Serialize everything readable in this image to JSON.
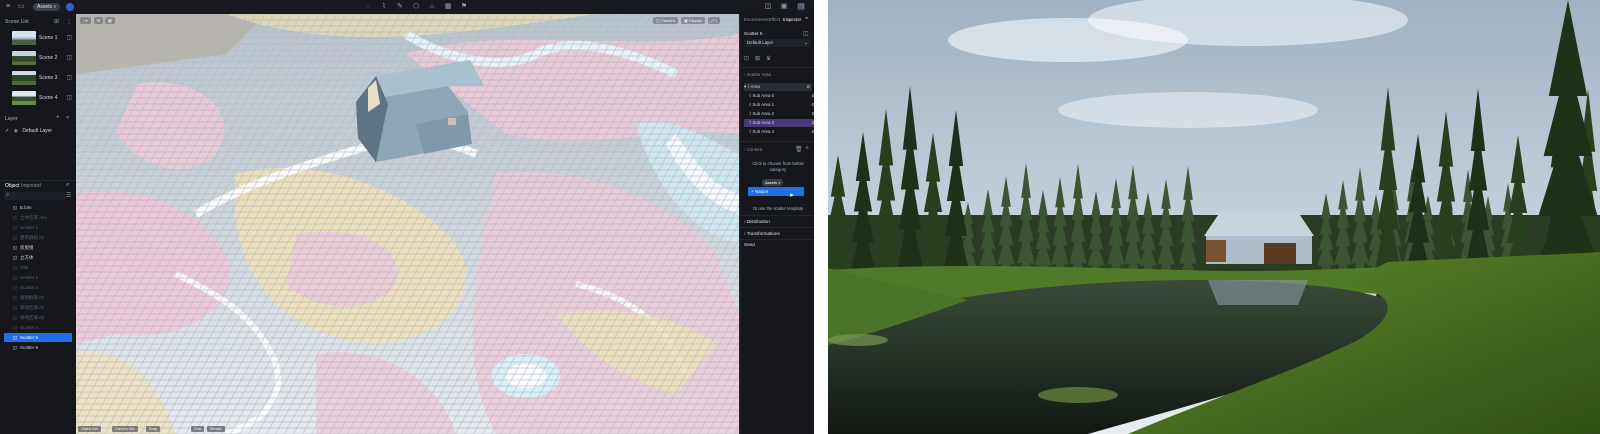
{
  "topbar": {
    "assets_label": "Assets"
  },
  "left": {
    "scene_list_title": "Scene List",
    "scenes": [
      "Scene 1",
      "Scene 2",
      "Scene 3",
      "Scene 4"
    ],
    "layer_title": "Layer",
    "default_layer": "Default Layer",
    "tabs": {
      "object": "Object",
      "imported": "Imported"
    },
    "objects": [
      {
        "label": "E.bim",
        "dim": false,
        "sel": false
      },
      {
        "label": "立体区域 Aim",
        "dim": true,
        "sel": false
      },
      {
        "label": "Scatter 1",
        "dim": true,
        "sel": false
      },
      {
        "label": "建筑群组 01",
        "dim": true,
        "sel": false
      },
      {
        "label": "房屋组",
        "dim": false,
        "sel": false
      },
      {
        "label": "立方体",
        "dim": false,
        "sel": false
      },
      {
        "label": "Villa",
        "dim": true,
        "sel": false
      },
      {
        "label": "Scatter 2",
        "dim": true,
        "sel": false
      },
      {
        "label": "Scatter 3",
        "dim": true,
        "sel": false
      },
      {
        "label": "植物群落 01",
        "dim": true,
        "sel": false
      },
      {
        "label": "草地区域 01",
        "dim": true,
        "sel": false
      },
      {
        "label": "林地区域 02",
        "dim": true,
        "sel": false
      },
      {
        "label": "Scatter 4",
        "dim": true,
        "sel": false
      },
      {
        "label": "Scatter 5",
        "dim": false,
        "sel": true
      },
      {
        "label": "Scatter 6",
        "dim": false,
        "sel": false
      }
    ]
  },
  "viewport": {
    "top_chips": [
      "Camera",
      "Display"
    ],
    "status_items": [
      "Object Info",
      "Camera Info",
      "Snap",
      "Grid",
      "Render"
    ]
  },
  "right": {
    "tabs": {
      "environment": "Environment",
      "effect": "Effect",
      "inspector": "Inspector"
    },
    "object_name": "Scatter 5",
    "layer_select": "Default Layer",
    "scatter_area_title": "Scatter Area",
    "areas": [
      "Area",
      "Sub Area 0",
      "Sub Area 1",
      "Sub Area 2",
      "Sub Area 3",
      "Sub Area 4"
    ],
    "content_title": "Content",
    "content_hint": "Click to choose from below category",
    "assets_tooltip": "Assets",
    "nature_label": "Nature",
    "template_hint": "Or use the scatter template",
    "distribution_label": "Distribution",
    "transformations_label": "Transformations",
    "seed_label": "Seed"
  },
  "colors": {
    "accent": "#1f6fe6",
    "panel": "#15171c",
    "highlight": "#4b3a7a"
  }
}
